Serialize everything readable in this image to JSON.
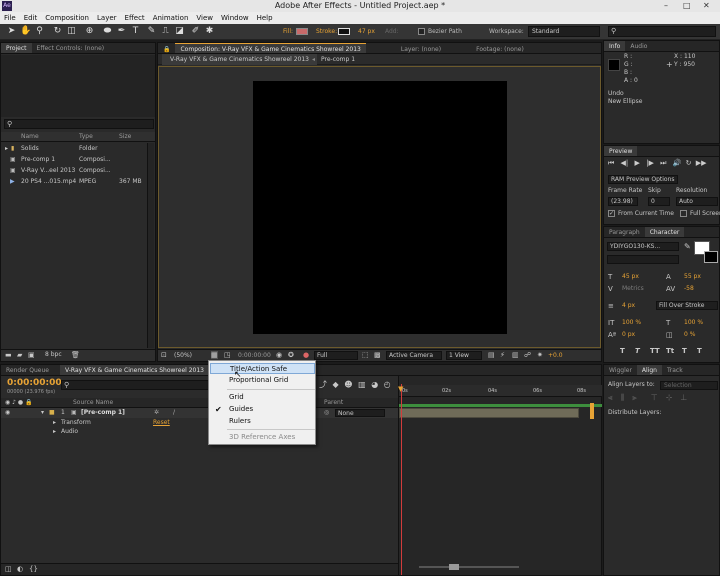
{
  "window": {
    "title": "Adobe After Effects - Untitled Project.aep *",
    "app_icon": "Ae",
    "controls": [
      "–",
      "□",
      "✕"
    ]
  },
  "menubar": [
    "File",
    "Edit",
    "Composition",
    "Layer",
    "Effect",
    "Animation",
    "View",
    "Window",
    "Help"
  ],
  "toolbar": {
    "fill_label": "Fill:",
    "stroke_label": "Stroke:",
    "stroke_px": "47 px",
    "add_label": "Add:",
    "bezier_label": "Bezier Path",
    "workspace_label": "Workspace:",
    "workspace_value": "Standard"
  },
  "project_panel": {
    "tabs": [
      "Project",
      "Effect Controls: (none)"
    ],
    "columns": [
      "Name",
      "Type",
      "Size"
    ],
    "items": [
      {
        "name": "Solids",
        "type": "Folder",
        "size": "",
        "icon": "folder-icon"
      },
      {
        "name": "Pre-comp 1",
        "type": "Composi...",
        "size": "",
        "icon": "composition-icon"
      },
      {
        "name": "V-Ray V...eel 2013",
        "type": "Composi...",
        "size": "",
        "icon": "composition-icon"
      },
      {
        "name": "20 PS4 ...015.mp4",
        "type": "MPEG",
        "size": "367 MB",
        "icon": "footage-icon"
      }
    ],
    "bpc": "8 bpc"
  },
  "comp_panel": {
    "tabs": [
      "Composition: V-Ray VFX & Game Cinematics Showreel 2013",
      "Layer: (none)",
      "Footage: (none)"
    ],
    "breadcrumbs": [
      "V-Ray VFX & Game Cinematics Showreel 2013",
      "Pre-comp 1"
    ],
    "zoom": "(50%)",
    "timecode": "0:00:00:00",
    "resolution": "Full",
    "camera": "Active Camera",
    "view": "1 View",
    "exposure": "+0.0"
  },
  "info_panel": {
    "tabs": [
      "Info",
      "Audio"
    ],
    "r": "R :",
    "g": "G :",
    "b": "B :",
    "a": "A : 0",
    "x": "X : 110",
    "y": "Y : 950",
    "undo": "Undo",
    "action": "New Ellipse"
  },
  "preview_panel": {
    "tab": "Preview",
    "ram_options": "RAM Preview Options",
    "frame_rate_label": "Frame Rate",
    "skip_label": "Skip",
    "resolution_label": "Resolution",
    "frame_rate": "(23.98)",
    "skip": "0",
    "resolution": "Auto",
    "from_current": "From Current Time",
    "full_screen": "Full Screen"
  },
  "character_panel": {
    "tabs": [
      "Paragraph",
      "Character"
    ],
    "font": "YDIYGO130-KS...",
    "size": "45 px",
    "leading": "55 px",
    "kerning": "Metrics",
    "tracking": "-58",
    "stroke_width": "4 px",
    "stroke_type": "Fill Over Stroke",
    "vscale": "100 %",
    "hscale": "100 %",
    "baseline": "0 px",
    "tsume": "0 %",
    "style_buttons": [
      "T",
      "T",
      "TT",
      "Tt",
      "T",
      "T"
    ]
  },
  "align_panel": {
    "tabs": [
      "Wiggler",
      "Align",
      "Track"
    ],
    "align_layers_to": "Align Layers to:",
    "selection": "Selection",
    "distribute": "Distribute Layers:"
  },
  "timeline": {
    "tabs": [
      "Render Queue",
      "V-Ray VFX & Game Cinematics Showreel 2013"
    ],
    "timecode": "0:00:00:00",
    "fps": "00000 (23.976 fps)",
    "source_name": "Source Name",
    "parent": "Parent",
    "layers": [
      {
        "num": "1",
        "name": "[Pre-comp 1]",
        "parent": "None"
      }
    ],
    "props": [
      {
        "name": "Transform",
        "value": "Reset"
      },
      {
        "name": "Audio",
        "value": ""
      }
    ],
    "ruler": [
      "0s",
      "02s",
      "04s",
      "06s",
      "08s"
    ]
  },
  "context_menu": {
    "items": [
      {
        "label": "Title/Action Safe",
        "state": "highlighted",
        "checked": false
      },
      {
        "label": "Proportional Grid",
        "state": "normal",
        "checked": false
      },
      {
        "label": "Grid",
        "state": "normal",
        "checked": false
      },
      {
        "label": "Guides",
        "state": "normal",
        "checked": true
      },
      {
        "label": "Rulers",
        "state": "normal",
        "checked": false
      },
      {
        "label": "3D Reference Axes",
        "state": "disabled",
        "checked": false
      }
    ]
  },
  "colors": {
    "accent_orange": "#e7a335",
    "current_time": "#d23c3c",
    "work_area": "#3d8e3d",
    "layer_bar": "#6f6b58",
    "fill_swatch": "#c86a6a"
  }
}
